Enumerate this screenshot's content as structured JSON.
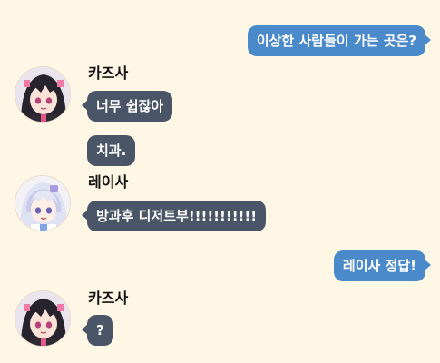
{
  "messages": {
    "m1": "이상한 사람들이 가는 곳은?",
    "m2": "너무 쉽잖아",
    "m3": "치과.",
    "m4": "방과후 디저트부!!!!!!!!!!!",
    "m5": "레이사 정답!",
    "m6": "?"
  },
  "senders": {
    "kazusa": "카즈사",
    "reisa": "레이사"
  },
  "colors": {
    "background": "#fff7e5",
    "outgoing_bubble": "#4a8acb",
    "incoming_bubble": "#4a5568"
  }
}
